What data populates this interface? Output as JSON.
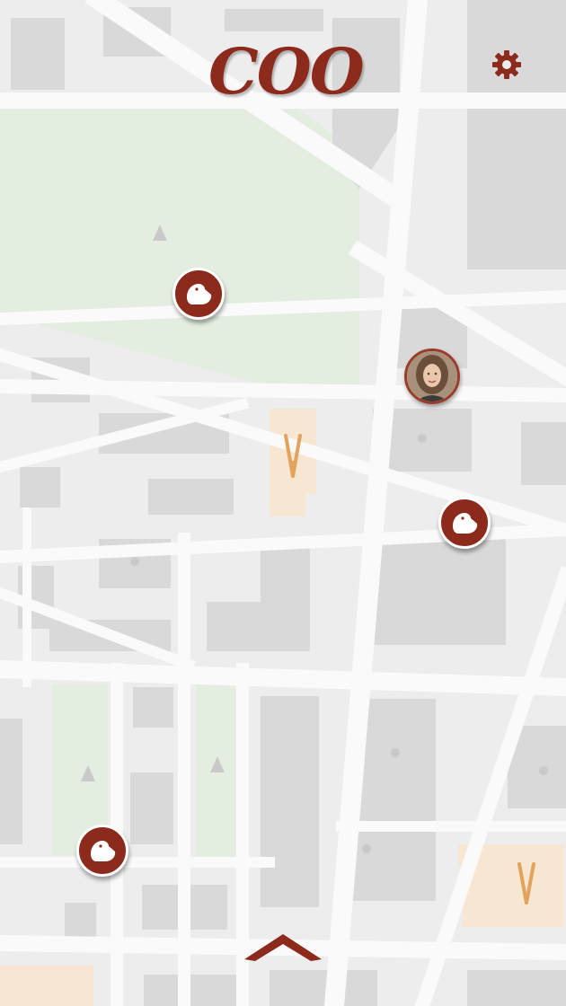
{
  "app": {
    "logo_text": "COO"
  },
  "header": {
    "settings_icon": "gear-icon",
    "accent_color": "#8c2a1c"
  },
  "map": {
    "background_color": "#ececec",
    "road_color": "#ffffff",
    "block_color": "#d9d9d9",
    "park_color": "#e6efe1",
    "highlight_color": "#f6e6d2"
  },
  "markers": {
    "pigeon_icon": "pigeon-icon",
    "avatar_icon": "user-avatar-icon",
    "marker_color": "#8c2a1c"
  },
  "bottom_sheet": {
    "expand_icon": "chevron-up-icon"
  }
}
